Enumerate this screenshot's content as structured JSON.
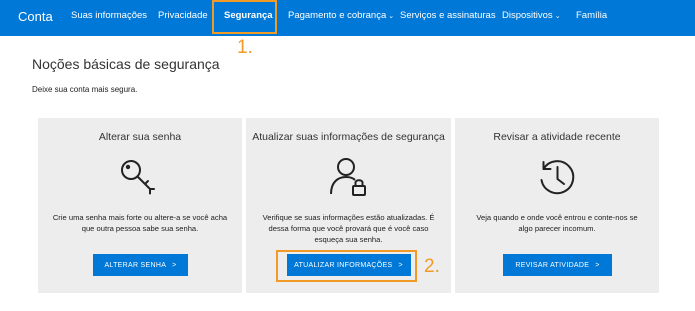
{
  "nav": {
    "brand": "Conta",
    "items": [
      {
        "label": "Suas informações",
        "dropdown": false
      },
      {
        "label": "Privacidade",
        "dropdown": false
      },
      {
        "label": "Segurança",
        "dropdown": false,
        "active": true
      },
      {
        "label": "Pagamento e cobrança",
        "dropdown": true
      },
      {
        "label": "Serviços e assinaturas",
        "dropdown": false
      },
      {
        "label": "Dispositivos",
        "dropdown": true
      },
      {
        "label": "Família",
        "dropdown": false
      }
    ],
    "chevron": "⌄"
  },
  "annotations": {
    "step1": "1.",
    "step2": "2.",
    "color": "#f29a26"
  },
  "page": {
    "title": "Noções básicas de segurança",
    "subtitle": "Deixe sua conta mais segura."
  },
  "cards": [
    {
      "title": "Alterar sua senha",
      "icon": "key-icon",
      "description": "Crie uma senha mais forte ou altere-a se você acha que outra pessoa sabe sua senha.",
      "button": "ALTERAR SENHA"
    },
    {
      "title": "Atualizar suas informações de segurança",
      "icon": "user-lock-icon",
      "description": "Verifique se suas informações estão atualizadas. É dessa forma que você provará que é você caso esqueça sua senha.",
      "button": "ATUALIZAR INFORMAÇÕES"
    },
    {
      "title": "Revisar a atividade recente",
      "icon": "history-clock-icon",
      "description": "Veja quando e onde você entrou e conte-nos se algo parecer incomum.",
      "button": "REVISAR ATIVIDADE"
    }
  ],
  "colors": {
    "accent": "#0078d7",
    "card_bg": "#ededed"
  }
}
